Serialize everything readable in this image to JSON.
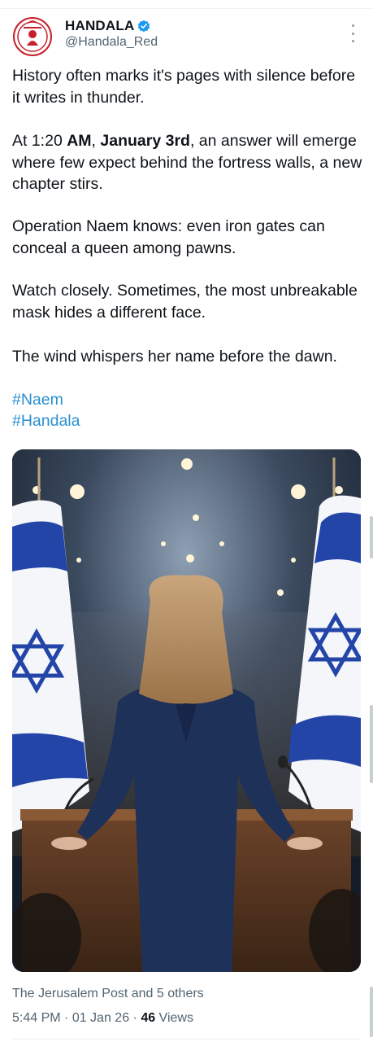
{
  "account": {
    "name": "HANDALA",
    "handle": "@Handala_Red",
    "avatar_icon": "handala-logo-icon",
    "verified_icon": "verified-badge-icon"
  },
  "tweet": {
    "p1": "History often marks it's pages with silence before it writes in thunder.",
    "p2_pre": "At 1:20 ",
    "p2_bold1": "AM",
    "p2_mid": ", ",
    "p2_bold2": "January 3rd",
    "p2_post": ", an answer will emerge where few expect behind the fortress walls, a new chapter stirs.",
    "p3": "Operation Naem knows: even iron gates can conceal a queen among pawns.",
    "p4": "Watch closely. Sometimes, the most unbreakable mask hides a different face.",
    "p5": "The wind whispers her name before the dawn.",
    "hashtags": [
      "#Naem",
      "#Handala"
    ]
  },
  "media": {
    "icon": "image-woman-at-podium-with-flags"
  },
  "source_text": "The Jerusalem Post and 5 others",
  "meta": {
    "time": "5:44 PM",
    "sep": " · ",
    "date": "01 Jan 26",
    "views_count": "46",
    "views_label": " Views"
  },
  "colors": {
    "accent": "#1d9bf0",
    "secondary_text": "#536471",
    "flag_blue": "#2345a8"
  }
}
